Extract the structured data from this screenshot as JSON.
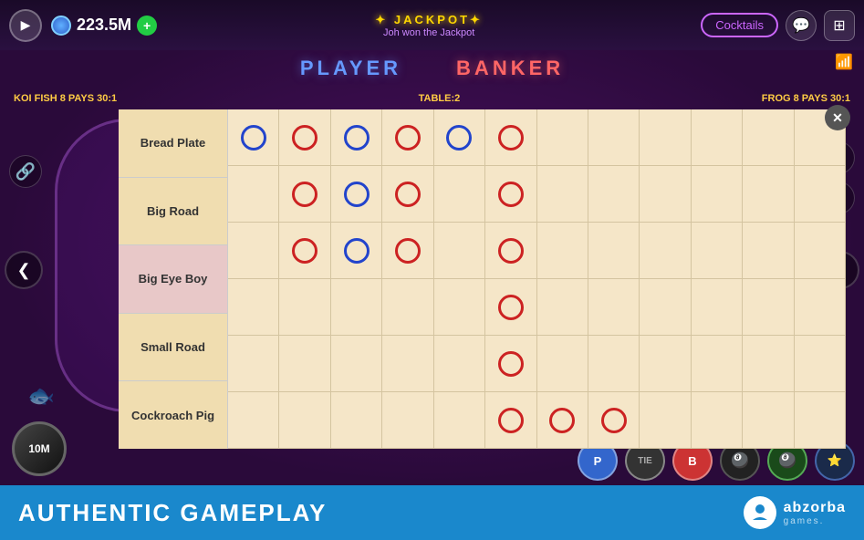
{
  "topbar": {
    "coin_amount": "223.5M",
    "jackpot_title": "JACKPOT",
    "jackpot_subtitle": "Joh won the Jackpot",
    "cocktails_label": "Cocktails",
    "play_icon": "▶",
    "add_icon": "+",
    "chat_icon": "💬",
    "grid_icon": "⊞"
  },
  "game": {
    "player_label": "PLAYER",
    "banker_label": "BANKER",
    "koi_fish_info": "KOI FISH 8 PAYS 30:1",
    "table_info": "TABLE:2",
    "frog_info": "FROG 8 PAYS 30:1"
  },
  "road_panel": {
    "close_icon": "✕",
    "labels": [
      {
        "id": "bread-plate",
        "text": "Bread Plate",
        "active": false
      },
      {
        "id": "big-road",
        "text": "Big Road",
        "active": false
      },
      {
        "id": "big-eye-boy",
        "text": "Big Eye Boy",
        "active": true
      },
      {
        "id": "small-road",
        "text": "Small Road",
        "active": false
      },
      {
        "id": "cockroach-pig",
        "text": "Cockroach Pig",
        "active": false
      }
    ],
    "grid": {
      "cols": 12,
      "rows": 6,
      "circles": [
        {
          "row": 0,
          "col": 0,
          "type": "blue"
        },
        {
          "row": 0,
          "col": 1,
          "type": "red"
        },
        {
          "row": 0,
          "col": 2,
          "type": "blue"
        },
        {
          "row": 0,
          "col": 3,
          "type": "red"
        },
        {
          "row": 0,
          "col": 4,
          "type": "blue"
        },
        {
          "row": 0,
          "col": 5,
          "type": "red"
        },
        {
          "row": 1,
          "col": 1,
          "type": "red"
        },
        {
          "row": 1,
          "col": 2,
          "type": "blue"
        },
        {
          "row": 1,
          "col": 3,
          "type": "red"
        },
        {
          "row": 1,
          "col": 5,
          "type": "red"
        },
        {
          "row": 2,
          "col": 1,
          "type": "red"
        },
        {
          "row": 2,
          "col": 2,
          "type": "blue"
        },
        {
          "row": 2,
          "col": 3,
          "type": "red"
        },
        {
          "row": 2,
          "col": 5,
          "type": "red"
        },
        {
          "row": 3,
          "col": 5,
          "type": "red"
        },
        {
          "row": 4,
          "col": 5,
          "type": "red"
        },
        {
          "row": 5,
          "col": 5,
          "type": "red"
        },
        {
          "row": 5,
          "col": 6,
          "type": "red"
        },
        {
          "row": 5,
          "col": 7,
          "type": "red"
        }
      ]
    }
  },
  "action_buttons": {
    "p_label": "P",
    "tie_label": "TIE",
    "b_label": "B"
  },
  "bottom_bar": {
    "authentic_text": "AUTHENTIC GAMEPLAY",
    "brand_name": "abzorba",
    "brand_sub": "games."
  },
  "nav": {
    "left_arrow": "❮",
    "right_arrow": "❯",
    "down_arrow": "❯"
  },
  "chips": {
    "amount_10m": "10M"
  },
  "wifi_bars": "📶"
}
